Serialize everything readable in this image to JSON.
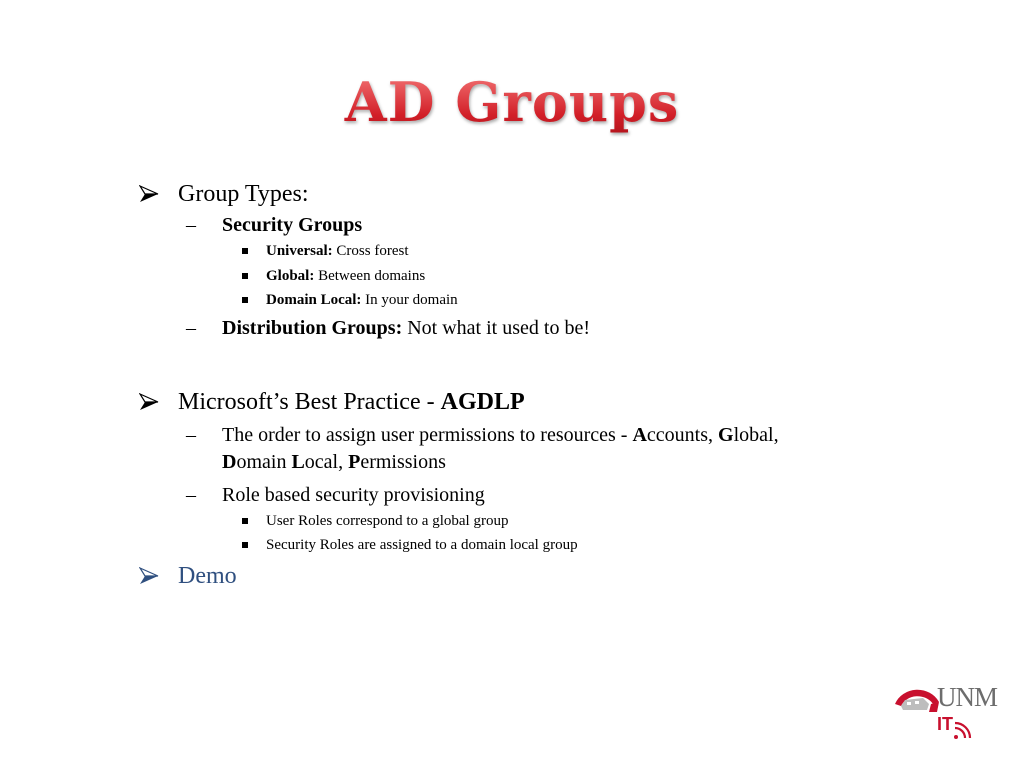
{
  "slide": {
    "title": "AD Groups",
    "sections": {
      "group_types": {
        "heading": "Group Types:",
        "security_groups": {
          "label": "Security Groups",
          "items": [
            {
              "term": "Universal:",
              "desc": " Cross forest"
            },
            {
              "term": "Global:",
              "desc": " Between domains"
            },
            {
              "term": "Domain Local:",
              "desc": " In your domain"
            }
          ]
        },
        "distribution_groups": {
          "term": "Distribution Groups:",
          "desc": " Not what it used to be!"
        }
      },
      "best_practice": {
        "heading_prefix": "Microsoft’s Best Practice - ",
        "heading_bold": "AGDLP",
        "order": {
          "prefix": "The order to assign user permissions to resources - ",
          "parts": [
            {
              "b": "A",
              "r": "ccounts, "
            },
            {
              "b": "G",
              "r": "lobal, "
            },
            {
              "b": "D",
              "r": "omain "
            },
            {
              "b": "L",
              "r": "ocal, "
            },
            {
              "b": "P",
              "r": "ermissions"
            }
          ]
        },
        "role_based": {
          "label": "Role based security provisioning",
          "items": [
            "User Roles correspond to a global group",
            "Security Roles are assigned to a domain local group"
          ]
        }
      },
      "demo": {
        "label": "Demo",
        "color": "#2f4f7f"
      }
    },
    "bullet_glyphs": {
      "level1": "arrow-bullet",
      "level2": "–",
      "level3": "square-bullet"
    },
    "logo": {
      "name": "UNM",
      "sub": "IT",
      "accent": "#c8102e"
    },
    "title_color": "#d21f28"
  }
}
